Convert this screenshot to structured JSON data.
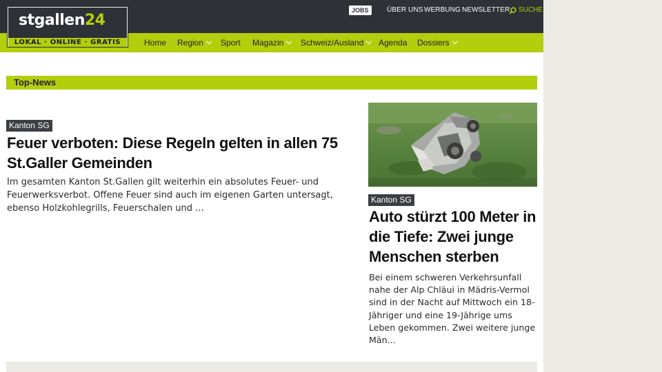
{
  "logo": {
    "name_main": "stgallen",
    "name_num": "24",
    "tagline": "LOKAL · ONLINE · GRATIS"
  },
  "topnav": {
    "jobs": "JOBS",
    "links": [
      "ÜBER UNS",
      "WERBUNG",
      "NEWSLETTER"
    ],
    "search": "SUCHE"
  },
  "mainnav": [
    {
      "label": "Home",
      "dropdown": false
    },
    {
      "label": "Region",
      "dropdown": true
    },
    {
      "label": "Sport",
      "dropdown": false
    },
    {
      "label": "Magazin",
      "dropdown": true
    },
    {
      "label": "Schweiz/Ausland",
      "dropdown": true
    },
    {
      "label": "Agenda",
      "dropdown": false
    },
    {
      "label": "Dossiers",
      "dropdown": true
    }
  ],
  "section": {
    "title": "Top-News"
  },
  "articles": [
    {
      "tag": "Kanton SG",
      "headline": "Feuer verboten: Diese Regeln gelten in allen 75 St.Galler Gemeinden",
      "teaser": "Im gesamten Kanton St.Gallen gilt weiterhin ein absolutes Feuer- und Feuerwerksverbot. Offene Feuer sind auch im eigenen Garten untersagt, ebenso Holzkohlegrills, Feuerschalen und ..."
    },
    {
      "tag": "Kanton SG",
      "headline": "Auto stürzt 100 Meter in die Tiefe: Zwei junge Menschen sterben",
      "teaser": "Bei einem schweren Verkehrsunfall nahe der Alp Chläui in Mädris-Vermol sind in der Nacht auf Mittwoch ein 18-Jähriger und eine 19-Jährige ums Leben gekommen. Zwei weitere junge Män..."
    }
  ],
  "colors": {
    "brand_green": "#b3ce0d",
    "header_dark": "#2e3136",
    "tag_bg": "#3b3e42"
  }
}
